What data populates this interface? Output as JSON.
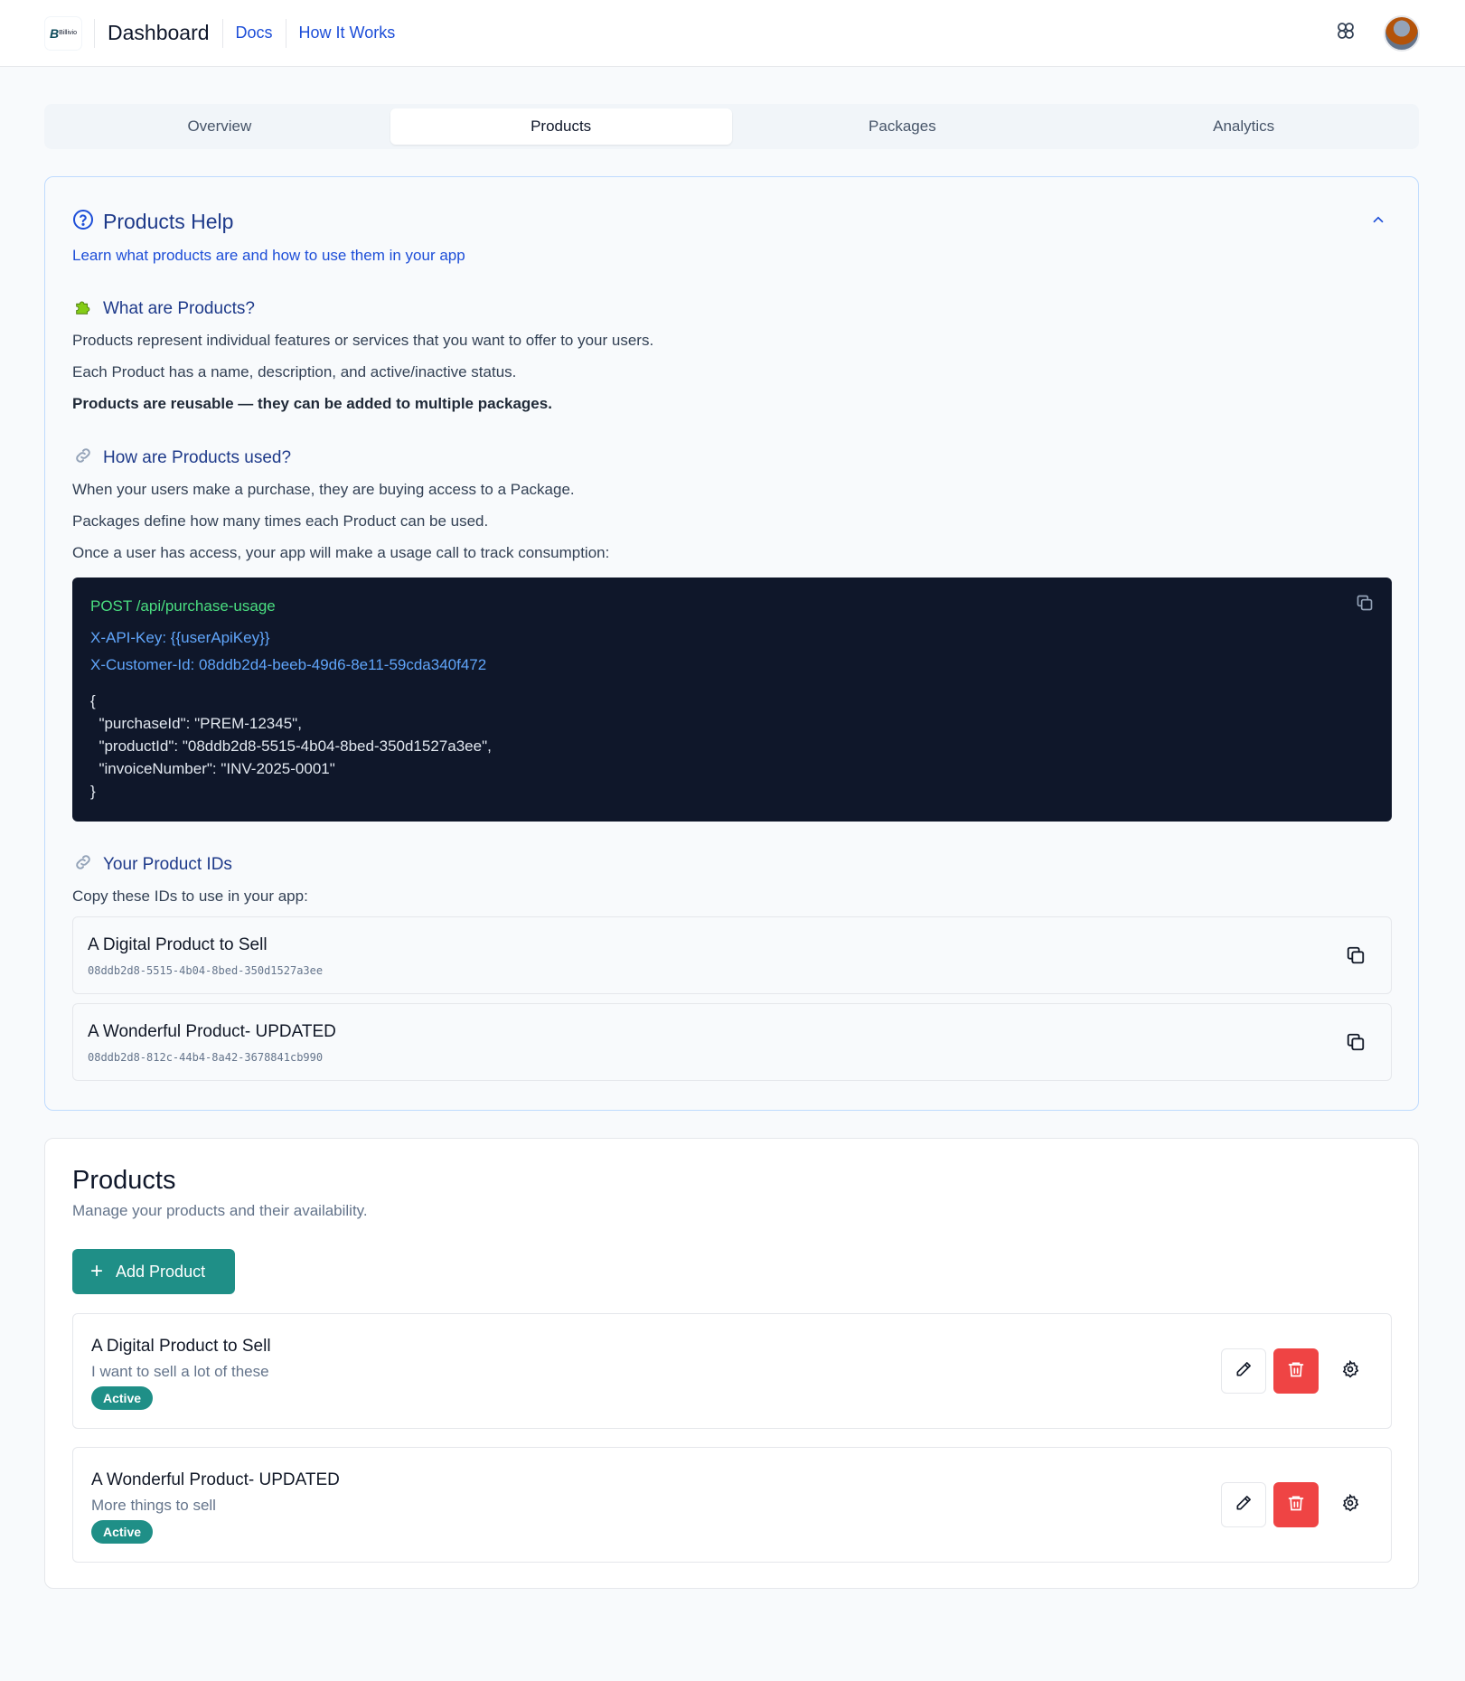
{
  "header": {
    "logo_text": "Billivio",
    "logo_letter": "B",
    "title": "Dashboard",
    "nav": [
      {
        "label": "Docs"
      },
      {
        "label": "How It Works"
      }
    ]
  },
  "tabs": [
    {
      "label": "Overview",
      "active": false
    },
    {
      "label": "Products",
      "active": true
    },
    {
      "label": "Packages",
      "active": false
    },
    {
      "label": "Analytics",
      "active": false
    }
  ],
  "help": {
    "title": "Products Help",
    "subtitle": "Learn what products are and how to use them in your app",
    "what": {
      "heading": "What are Products?",
      "lines": [
        "Products represent individual features or services that you want to offer to your users.",
        "Each Product has a name, description, and active/inactive status.",
        "Products are reusable — they can be added to multiple packages."
      ]
    },
    "how": {
      "heading": "How are Products used?",
      "lines": [
        "When your users make a purchase, they are buying access to a Package.",
        "Packages define how many times each Product can be used.",
        "Once a user has access, your app will make a usage call to track consumption:"
      ]
    },
    "code": {
      "request": "POST /api/purchase-usage",
      "api_key": "X-API-Key: {{userApiKey}}",
      "customer_id": "X-Customer-Id: 08ddb2d4-beeb-49d6-8e11-59cda340f472",
      "body": [
        "{",
        "  \"purchaseId\": \"PREM-12345\",",
        "  \"productId\": \"08ddb2d8-5515-4b04-8bed-350d1527a3ee\",",
        "  \"invoiceNumber\": \"INV-2025-0001\"",
        "}"
      ]
    },
    "ids": {
      "heading": "Your Product IDs",
      "intro": "Copy these IDs to use in your app:",
      "items": [
        {
          "name": "A Digital Product to Sell",
          "id": "08ddb2d8-5515-4b04-8bed-350d1527a3ee"
        },
        {
          "name": "A Wonderful Product- UPDATED",
          "id": "08ddb2d8-812c-44b4-8a42-3678841cb990"
        }
      ]
    }
  },
  "products": {
    "title": "Products",
    "subtitle": "Manage your products and their availability.",
    "add_label": "Add Product",
    "items": [
      {
        "name": "A Digital Product to Sell",
        "description": "I want to sell a lot of these",
        "status": "Active"
      },
      {
        "name": "A Wonderful Product- UPDATED",
        "description": "More things to sell",
        "status": "Active"
      }
    ]
  },
  "colors": {
    "accent": "#1f8f87",
    "danger": "#ef4444",
    "link": "#1d4ed8",
    "code_bg": "#0f172a"
  }
}
